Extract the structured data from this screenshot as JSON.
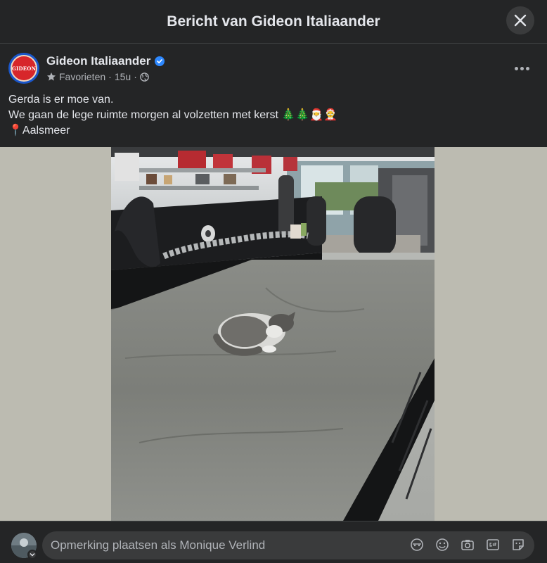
{
  "header": {
    "title": "Bericht van Gideon Italiaander"
  },
  "post": {
    "author": "Gideon Italiaander",
    "avatar_text": "GIDEON",
    "audience": "Favorieten",
    "time": "15u",
    "lines": [
      "Gerda is er moe van.",
      "We gaan de lege ruimte morgen al volzetten met kerst 🎄🎄🎅🤶",
      "📍Aalsmeer"
    ]
  },
  "composer": {
    "placeholder": "Opmerking plaatsen als Monique Verlind"
  },
  "icons": {
    "close": "close-icon",
    "more": "more-icon",
    "verified": "verified-badge-icon",
    "favorites": "star-icon",
    "audience": "globe-icon",
    "avatar_toggle": "chevron-down-icon",
    "comment_tools": [
      "avatar-sticker-icon",
      "emoji-icon",
      "camera-icon",
      "gif-icon",
      "sticker-icon"
    ]
  },
  "colors": {
    "background": "#242526",
    "accent": "#2d88ff",
    "brand": "#d7262a"
  }
}
